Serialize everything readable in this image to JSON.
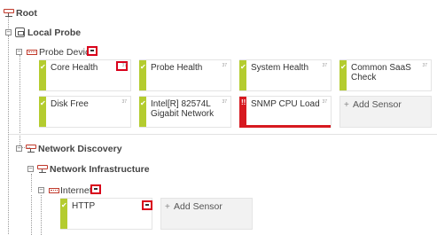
{
  "tree": {
    "root": {
      "label": "Root",
      "expander": "−"
    },
    "local_probe": {
      "label": "Local Probe",
      "expander": "−"
    },
    "probe_device": {
      "label": "Probe Device",
      "expander": "−"
    },
    "network_discovery": {
      "label": "Network Discovery",
      "expander": "−"
    },
    "network_infrastructure": {
      "label": "Network Infrastructure",
      "expander": "−"
    },
    "internet": {
      "label": "Internet",
      "expander": "−"
    }
  },
  "probe_device_sensors": [
    {
      "name": "Core Health",
      "status": "up",
      "mini": "37"
    },
    {
      "name": "Probe Health",
      "status": "up",
      "mini": "37"
    },
    {
      "name": "System Health",
      "status": "up",
      "mini": "37"
    },
    {
      "name": "Common SaaS Check",
      "status": "up",
      "mini": "37"
    },
    {
      "name": "Disk Free",
      "status": "up",
      "mini": "37"
    },
    {
      "name": "Intel[R] 82574L Gigabit Network",
      "status": "up",
      "mini": "37"
    },
    {
      "name": "SNMP CPU Load",
      "status": "down",
      "mini": "37"
    }
  ],
  "internet_sensors": [
    {
      "name": "HTTP",
      "status": "up"
    }
  ],
  "add_sensor_label": "Add Sensor",
  "add_sensor_icon": "+",
  "check_icon_glyph": "✔",
  "alert_icon_glyph": "!!",
  "colors": {
    "up": "#b4cc2f",
    "down": "#d71920",
    "highlight": "#d9001b"
  }
}
